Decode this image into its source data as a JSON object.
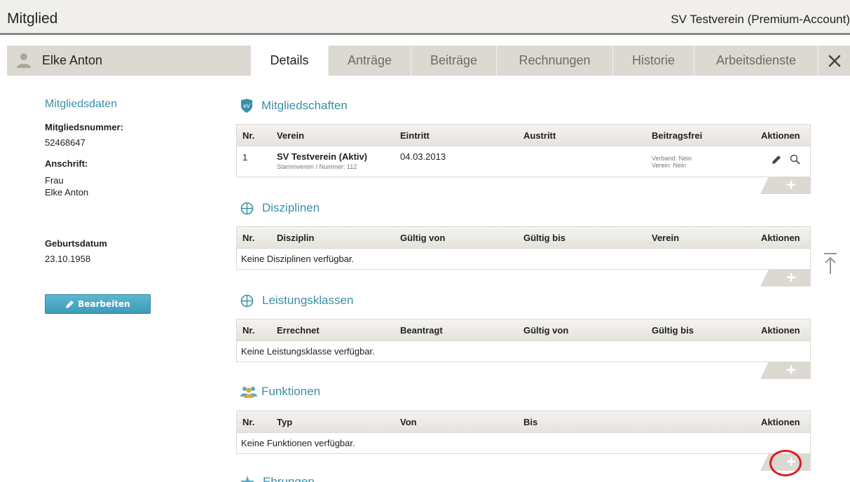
{
  "header": {
    "title": "Mitglied",
    "account": "SV Testverein (Premium-Account)"
  },
  "member": {
    "name": "Elke Anton"
  },
  "tabs": [
    {
      "label": "Details",
      "active": true
    },
    {
      "label": "Anträge"
    },
    {
      "label": "Beiträge"
    },
    {
      "label": "Rechnungen"
    },
    {
      "label": "Historie"
    },
    {
      "label": "Arbeitsdienste"
    }
  ],
  "left": {
    "section_title": "Mitgliedsdaten",
    "member_number_label": "Mitgliedsnummer:",
    "member_number": "52468647",
    "address_label": "Anschrift:",
    "address_line1": "Frau",
    "address_line2": "Elke Anton",
    "birthdate_label": "Geburtsdatum",
    "birthdate": "23.10.1958",
    "edit_button": "Bearbeiten"
  },
  "memberships": {
    "title": "Mitgliedschaften",
    "headers": [
      "Nr.",
      "Verein",
      "Eintritt",
      "Austritt",
      "Beitragsfrei",
      "Aktionen"
    ],
    "row": {
      "nr": "1",
      "verein": "SV Testverein (Aktiv)",
      "verein_sub": "Stammverein / Nummer: 112",
      "eintritt": "04.03.2013",
      "austritt": "",
      "beitragsfrei_1": "Verband: Nein",
      "beitragsfrei_2": "Verein: Nein"
    }
  },
  "disciplines": {
    "title": "Disziplinen",
    "headers": [
      "Nr.",
      "Disziplin",
      "Gültig von",
      "Gültig bis",
      "Verein",
      "Aktionen"
    ],
    "empty": "Keine Disziplinen verfügbar."
  },
  "classes": {
    "title": "Leistungsklassen",
    "headers": [
      "Nr.",
      "Errechnet",
      "Beantragt",
      "Gültig von",
      "Gültig bis",
      "Aktionen"
    ],
    "empty": "Keine Leistungsklasse verfügbar."
  },
  "functions": {
    "title": "Funktionen",
    "headers": [
      "Nr.",
      "Typ",
      "Von",
      "Bis",
      "Aktionen"
    ],
    "empty": "Keine Funktionen verfügbar."
  },
  "honors": {
    "title": "Ehrungen"
  },
  "colors": {
    "accent": "#3a8fa6",
    "button": "#4aa8c3",
    "highlight": "#e01b1b",
    "tabbar": "#dcd9d3"
  }
}
